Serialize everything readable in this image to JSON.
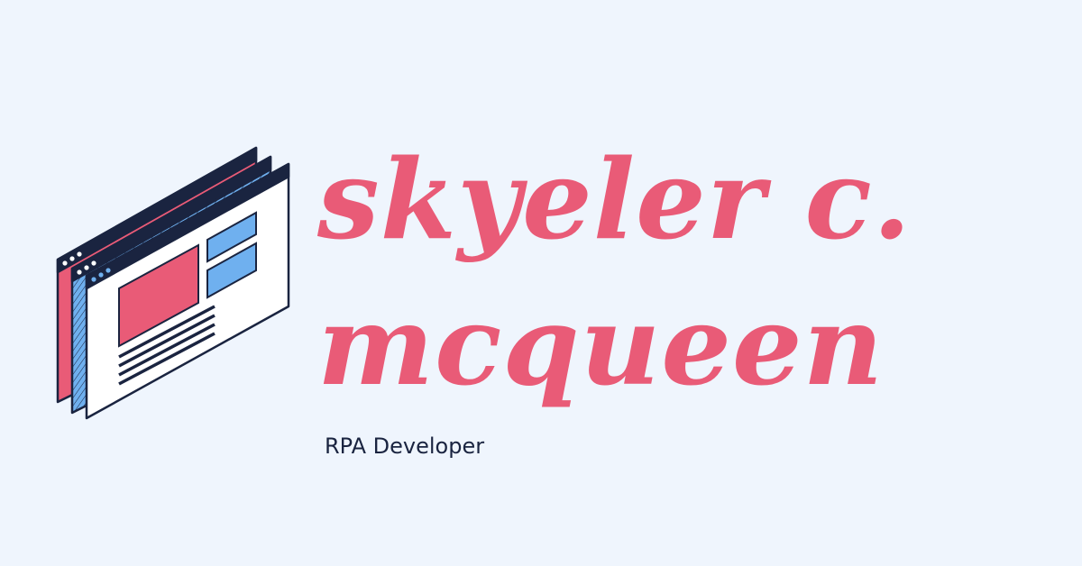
{
  "name_line_1": "skyeler c.",
  "name_line_2": "mcqueen",
  "role": "RPA Developer",
  "illustration": {
    "icon": "browser-windows-icon",
    "colors": {
      "pink": "#e95b77",
      "blue": "#6fb0ef",
      "navy": "#1a2440",
      "white": "#ffffff"
    }
  },
  "colors": {
    "background": "#eff5fd",
    "name": "#e95b77",
    "role": "#1a2440"
  }
}
